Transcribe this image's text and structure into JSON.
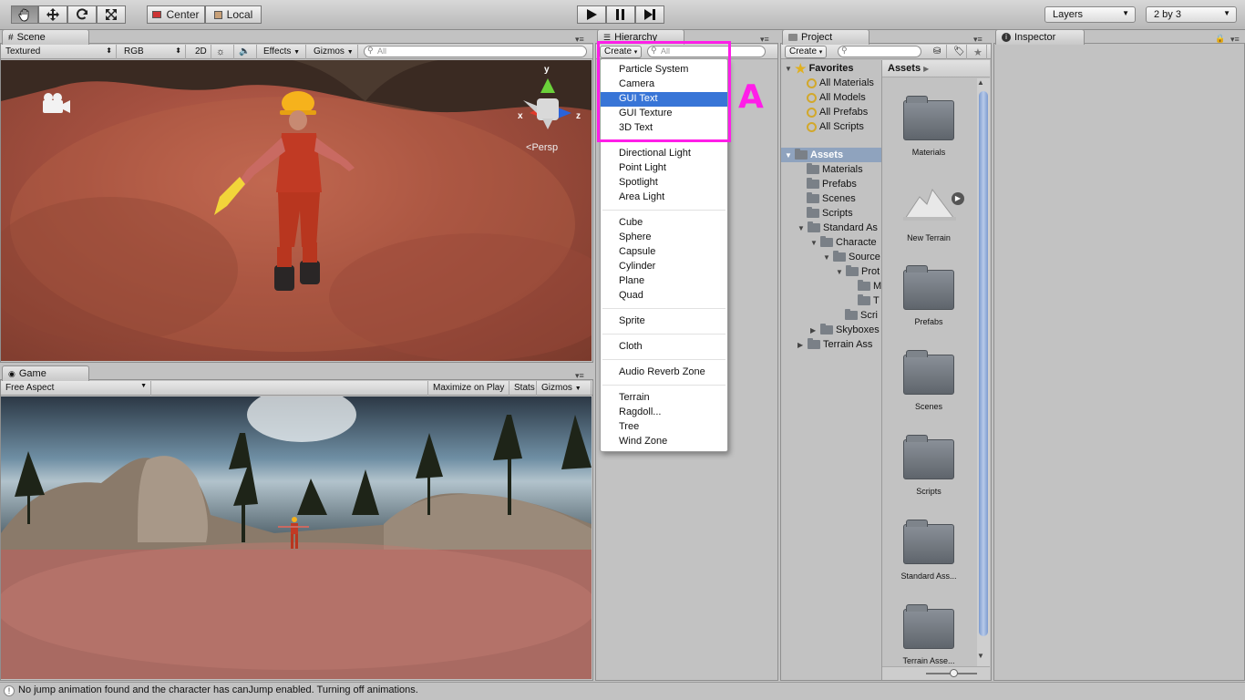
{
  "toolbar": {
    "pivot_label": "Center",
    "space_label": "Local",
    "layers_label": "Layers",
    "layout_label": "2 by 3"
  },
  "scene": {
    "tab_label": "Scene",
    "shading_mode": "Textured",
    "render_mode": "RGB",
    "mode_2d": "2D",
    "effects_label": "Effects",
    "gizmos_label": "Gizmos",
    "search_placeholder": "All",
    "gizmo_axes": {
      "y": "y",
      "x": "x",
      "z": "z"
    },
    "persp_label": "Persp"
  },
  "game": {
    "tab_label": "Game",
    "aspect_label": "Free Aspect",
    "maximize_label": "Maximize on Play",
    "stats_label": "Stats",
    "gizmos_label": "Gizmos"
  },
  "hierarchy": {
    "tab_label": "Hierarchy",
    "create_label": "Create",
    "search_placeholder": "All",
    "annotation_label": "A",
    "annotation_color": "#ff1ee8",
    "menu_groups": [
      [
        "Particle System",
        "Camera",
        "GUI Text",
        "GUI Texture",
        "3D Text"
      ],
      [
        "Directional Light",
        "Point Light",
        "Spotlight",
        "Area Light"
      ],
      [
        "Cube",
        "Sphere",
        "Capsule",
        "Cylinder",
        "Plane",
        "Quad"
      ],
      [
        "Sprite"
      ],
      [
        "Cloth"
      ],
      [
        "Audio Reverb Zone"
      ],
      [
        "Terrain",
        "Ragdoll...",
        "Tree",
        "Wind Zone"
      ]
    ],
    "selected_item": "GUI Text",
    "selection_color": "#3875d7"
  },
  "project": {
    "tab_label": "Project",
    "create_label": "Create",
    "favorites_label": "Favorites",
    "favorites": [
      "All Materials",
      "All Models",
      "All Prefabs",
      "All Scripts"
    ],
    "assets_label": "Assets",
    "tree": [
      "Materials",
      "Prefabs",
      "Scenes",
      "Scripts",
      "Standard As",
      "Characte",
      "Source",
      "Prot",
      "M",
      "T",
      "Scri",
      "Skyboxes",
      "Terrain Ass"
    ],
    "breadcrumb": "Assets",
    "grid_items": [
      "Materials",
      "New Terrain",
      "Prefabs",
      "Scenes",
      "Scripts",
      "Standard Ass...",
      "Terrain Asse..."
    ]
  },
  "inspector": {
    "tab_label": "Inspector"
  },
  "status_message": "No jump animation found and the character has canJump enabled. Turning off animations."
}
